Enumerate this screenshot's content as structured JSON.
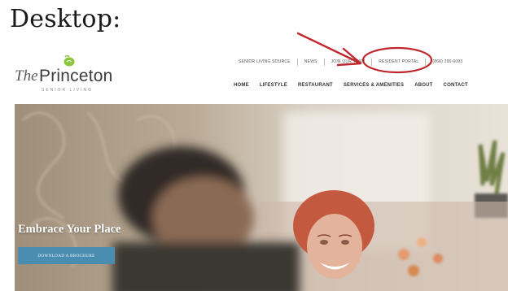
{
  "caption": "Desktop:",
  "logo": {
    "the": "The",
    "name": "Princeton",
    "sub": "SENIOR LIVING"
  },
  "utility_nav": [
    "SENIOR LIVING SOURCE",
    "NEWS",
    "JOIN OUR TEAM",
    "RESIDENT PORTAL",
    "(866) 290-6093"
  ],
  "main_nav": [
    "HOME",
    "LIFESTYLE",
    "RESTAURANT",
    "SERVICES & AMENITIES",
    "ABOUT",
    "CONTACT"
  ],
  "hero": {
    "title": "Embrace Your Place",
    "button": "DOWNLOAD A BROCHURE"
  },
  "colors": {
    "annotation": "#c0262d",
    "logo_green": "#8dc63f",
    "button": "#4a8db0"
  }
}
